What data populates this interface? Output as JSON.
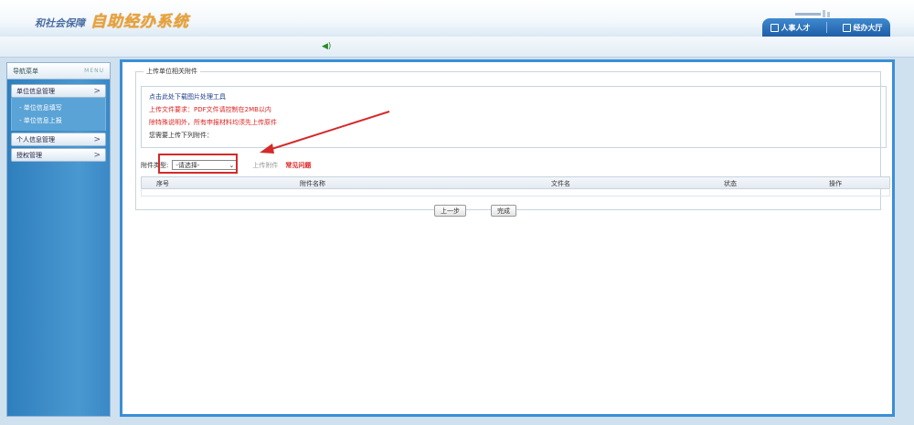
{
  "window": {
    "controls": [
      "—",
      "☐",
      "✕"
    ]
  },
  "header": {
    "logo_left": "和社会保障",
    "logo_right": "自助经办系统",
    "nav": [
      {
        "label": "人事人才",
        "icon": "user-icon"
      },
      {
        "label": "经办大厅",
        "icon": "hall-icon"
      }
    ]
  },
  "sidebar": {
    "title": "导航菜单",
    "menu_label": "MENU",
    "groups": [
      {
        "label": "单位信息管理",
        "children": [
          "- 单位信息填写",
          "- 单位信息上报"
        ]
      },
      {
        "label": "个人信息管理"
      },
      {
        "label": "授权管理"
      }
    ]
  },
  "main": {
    "section_title": "上传单位相关附件",
    "notices": {
      "line1": "点击此处下载图片处理工具",
      "line2": "上传文件要求：PDF文件请控制在2MB以内",
      "line3": "除特殊说明外，所有申报材料均须先上传原件",
      "line4": "您需要上传下列附件："
    },
    "attachment_type_label": "附件类型:",
    "select_value": "-请选择-",
    "upload_label": "上传附件",
    "faq_link": "常见问题",
    "table_headers": [
      "序号",
      "附件名称",
      "文件名",
      "状态",
      "操作"
    ],
    "buttons": {
      "prev": "上一步",
      "finish": "完成"
    }
  },
  "colors": {
    "accent": "#3a8fd6",
    "highlight_red": "#d42a2a"
  }
}
